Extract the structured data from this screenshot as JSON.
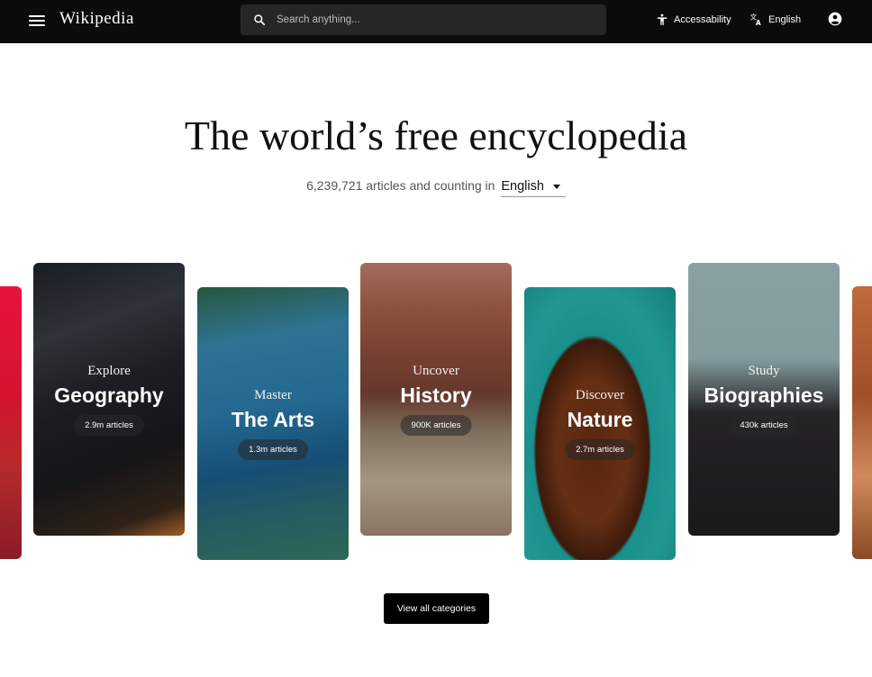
{
  "header": {
    "logo": "Wikipedia",
    "search_placeholder": "Search anything...",
    "accessibility_label": "Accessability",
    "language_label": "English"
  },
  "hero": {
    "headline": "The world’s free encyclopedia",
    "counter_text": "6,239,721 articles and counting in",
    "language_selected": "English"
  },
  "categories": [
    {
      "verb": "Explore",
      "name": "Geography",
      "count": "2.9m articles"
    },
    {
      "verb": "Master",
      "name": "The Arts",
      "count": "1.3m articles"
    },
    {
      "verb": "Uncover",
      "name": "History",
      "count": "900K articles"
    },
    {
      "verb": "Discover",
      "name": "Nature",
      "count": "2.7m articles"
    },
    {
      "verb": "Study",
      "name": "Biographies",
      "count": "430k articles"
    }
  ],
  "view_all_label": "View all categories"
}
